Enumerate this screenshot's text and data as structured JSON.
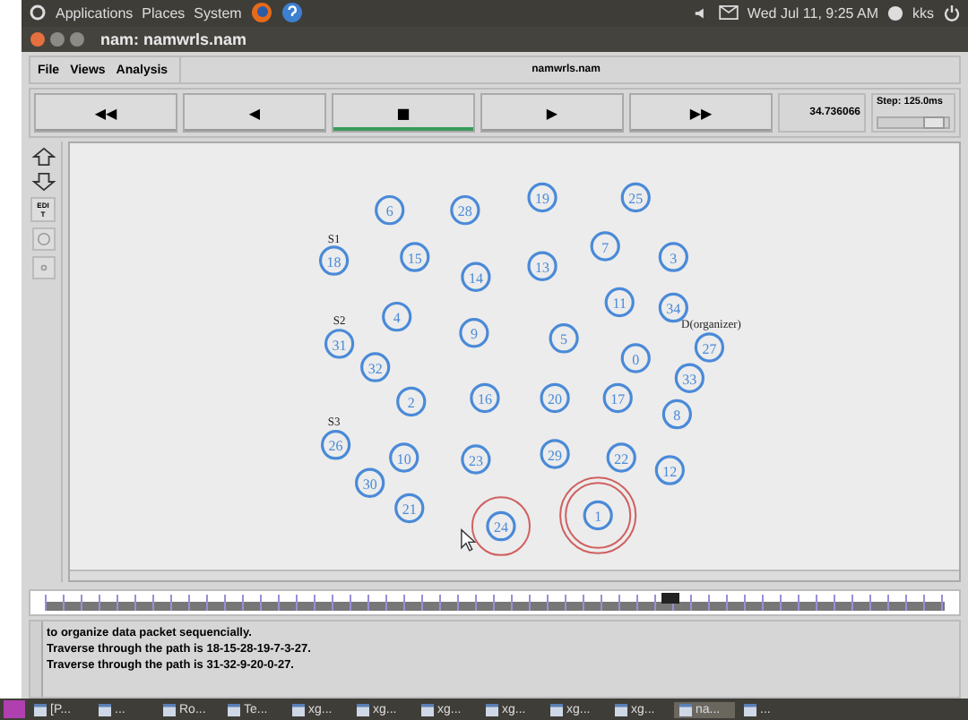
{
  "top_panel": {
    "menus": [
      "Applications",
      "Places",
      "System"
    ],
    "clock": "Wed Jul 11,  9:25 AM",
    "user": "kks"
  },
  "window": {
    "title": "nam: namwrls.nam"
  },
  "menu": {
    "items": [
      "File",
      "Views",
      "Analysis"
    ],
    "file_name": "namwrls.nam"
  },
  "controls": {
    "buttons": [
      {
        "glyph": "◀◀",
        "selected": false
      },
      {
        "glyph": "◀",
        "selected": false
      },
      {
        "glyph": "■",
        "selected": true
      },
      {
        "glyph": "▶",
        "selected": false
      },
      {
        "glyph": "▶▶",
        "selected": false
      }
    ],
    "time": "34.736066",
    "step": {
      "label": "Step: 125.0ms",
      "level": 0.85
    }
  },
  "tools": [
    {
      "kind": "zoom_in"
    },
    {
      "kind": "zoom_out"
    },
    {
      "kind": "text",
      "label": "EDIT"
    },
    {
      "kind": "circle"
    },
    {
      "kind": "dot"
    }
  ],
  "canvas": {
    "nodes": [
      {
        "label": "6",
        "kind": "plain"
      },
      {
        "label": "28",
        "kind": "plain"
      },
      {
        "label": "19",
        "kind": "plain"
      },
      {
        "label": "25",
        "kind": "plain"
      },
      {
        "label": "18",
        "kind": "plain"
      },
      {
        "label": "15",
        "kind": "plain"
      },
      {
        "label": "14",
        "kind": "plain"
      },
      {
        "label": "13",
        "kind": "plain"
      },
      {
        "label": "7",
        "kind": "plain"
      },
      {
        "label": "3",
        "kind": "plain"
      },
      {
        "label": "11",
        "kind": "plain"
      },
      {
        "label": "34",
        "kind": "plain"
      },
      {
        "label": "4",
        "kind": "plain"
      },
      {
        "label": "31",
        "kind": "plain"
      },
      {
        "label": "9",
        "kind": "plain"
      },
      {
        "label": "5",
        "kind": "plain"
      },
      {
        "label": "27",
        "kind": "plain"
      },
      {
        "label": "0",
        "kind": "plain"
      },
      {
        "label": "32",
        "kind": "plain"
      },
      {
        "label": "33",
        "kind": "plain"
      },
      {
        "label": "2",
        "kind": "plain"
      },
      {
        "label": "16",
        "kind": "plain"
      },
      {
        "label": "20",
        "kind": "plain"
      },
      {
        "label": "17",
        "kind": "plain"
      },
      {
        "label": "8",
        "kind": "plain"
      },
      {
        "label": "26",
        "kind": "plain"
      },
      {
        "label": "10",
        "kind": "plain"
      },
      {
        "label": "23",
        "kind": "plain"
      },
      {
        "label": "29",
        "kind": "plain"
      },
      {
        "label": "22",
        "kind": "plain"
      },
      {
        "label": "12",
        "kind": "plain"
      },
      {
        "label": "30",
        "kind": "plain"
      },
      {
        "label": "21",
        "kind": "plain"
      },
      {
        "label": "24",
        "kind": "ringed"
      },
      {
        "label": "1",
        "kind": "doubleringed"
      }
    ],
    "annotations": [
      "S1",
      "S2",
      "S3",
      "D(organizer)"
    ]
  },
  "timeline": {
    "level": 0.69
  },
  "log": [
    "to organize data packet sequencially.",
    "Traverse through the path is 18-15-28-19-7-3-27.",
    "Traverse through the path is 31-32-9-20-0-27."
  ],
  "taskbar": [
    {
      "label": "[P...",
      "selected": false
    },
    {
      "label": "...",
      "selected": false
    },
    {
      "label": "Ro...",
      "selected": false
    },
    {
      "label": "Te...",
      "selected": false
    },
    {
      "label": "xg...",
      "selected": false
    },
    {
      "label": "xg...",
      "selected": false
    },
    {
      "label": "xg...",
      "selected": false
    },
    {
      "label": "xg...",
      "selected": false
    },
    {
      "label": "xg...",
      "selected": false
    },
    {
      "label": "xg...",
      "selected": false
    },
    {
      "label": "na...",
      "selected": true
    },
    {
      "label": "...",
      "selected": false
    }
  ]
}
